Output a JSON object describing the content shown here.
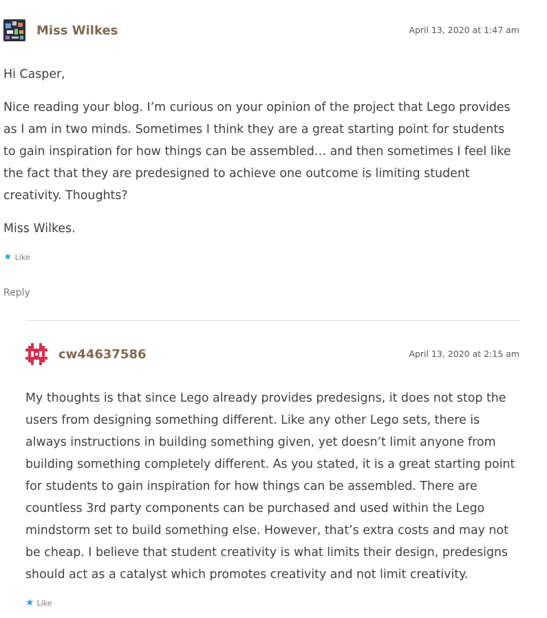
{
  "comments": [
    {
      "author": "Miss Wilkes",
      "date": "April 13, 2020 at 1:47 am",
      "paragraphs": [
        "Hi Casper,",
        "Nice reading your blog. I’m curious on your opinion of the project that Lego provides as I am in two minds. Sometimes I think they are a great starting point for students to gain inspiration for how things can be assembled… and then sometimes I feel like the fact that they are predesigned to achieve one outcome is limiting student creativity. Thoughts?",
        "Miss Wilkes."
      ],
      "like_label": "Like",
      "reply_label": "Reply"
    },
    {
      "author": "cw44637586",
      "date": "April 13, 2020 at 2:15 am",
      "paragraphs": [
        "My thoughts is that since Lego already provides predesigns, it does not stop the users from designing something different. Like any other Lego sets, there is always instructions in building something given, yet doesn’t limit anyone from building something completely different. As you stated, it is a great starting point for students to gain inspiration for how things can be assembled. There are countless 3rd party components can be purchased and used within the Lego mindstorm set to build something else. However, that’s extra costs and may not be cheap. I believe that student creativity is what limits their design, predesigns should act as a catalyst which promotes creativity and not limit creativity."
      ],
      "like_label": "Like"
    }
  ],
  "colors": {
    "author": "#7d6a50",
    "like_star": "#2e9fd4",
    "identicon": "#d6304f"
  },
  "icons": {
    "like": "star-icon",
    "avatar_1": "user-avatar-image",
    "avatar_2": "identicon-avatar"
  }
}
